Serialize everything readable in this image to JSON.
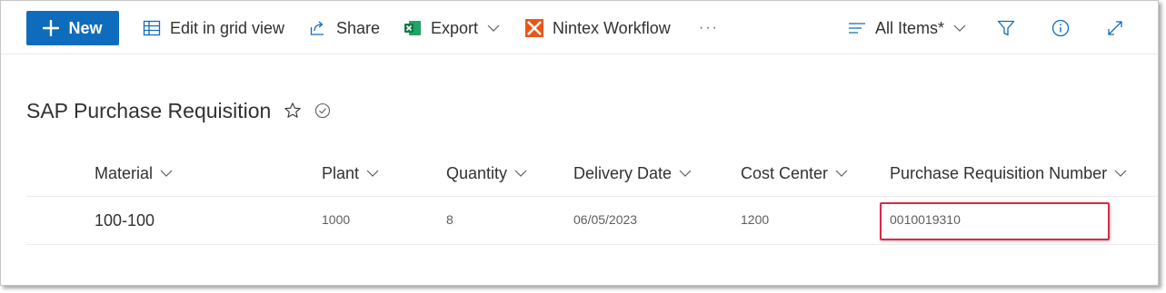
{
  "toolbar": {
    "new_label": "New",
    "edit_grid_label": "Edit in grid view",
    "share_label": "Share",
    "export_label": "Export",
    "nintex_label": "Nintex Workflow",
    "more_label": "···",
    "view_label": "All Items*"
  },
  "list": {
    "title": "SAP Purchase Requisition"
  },
  "table": {
    "columns": [
      "Material",
      "Plant",
      "Quantity",
      "Delivery Date",
      "Cost Center",
      "Purchase Requisition Number"
    ],
    "rows": [
      [
        "100-100",
        "1000",
        "8",
        "06/05/2023",
        "1200",
        "0010019310"
      ]
    ]
  },
  "colors": {
    "accent": "#0f6cbd",
    "excel": "#107c41",
    "nintex": "#e8571a",
    "highlight": "#d9294a"
  },
  "icons": {
    "new": "plus-icon",
    "grid": "grid-icon",
    "share": "share-icon",
    "export": "excel-icon",
    "nintex": "nintex-icon",
    "view": "lines-icon",
    "filter": "filter-icon",
    "info": "info-icon",
    "expand": "expand-icon",
    "favorite": "star-icon",
    "status": "check-circle-icon"
  }
}
